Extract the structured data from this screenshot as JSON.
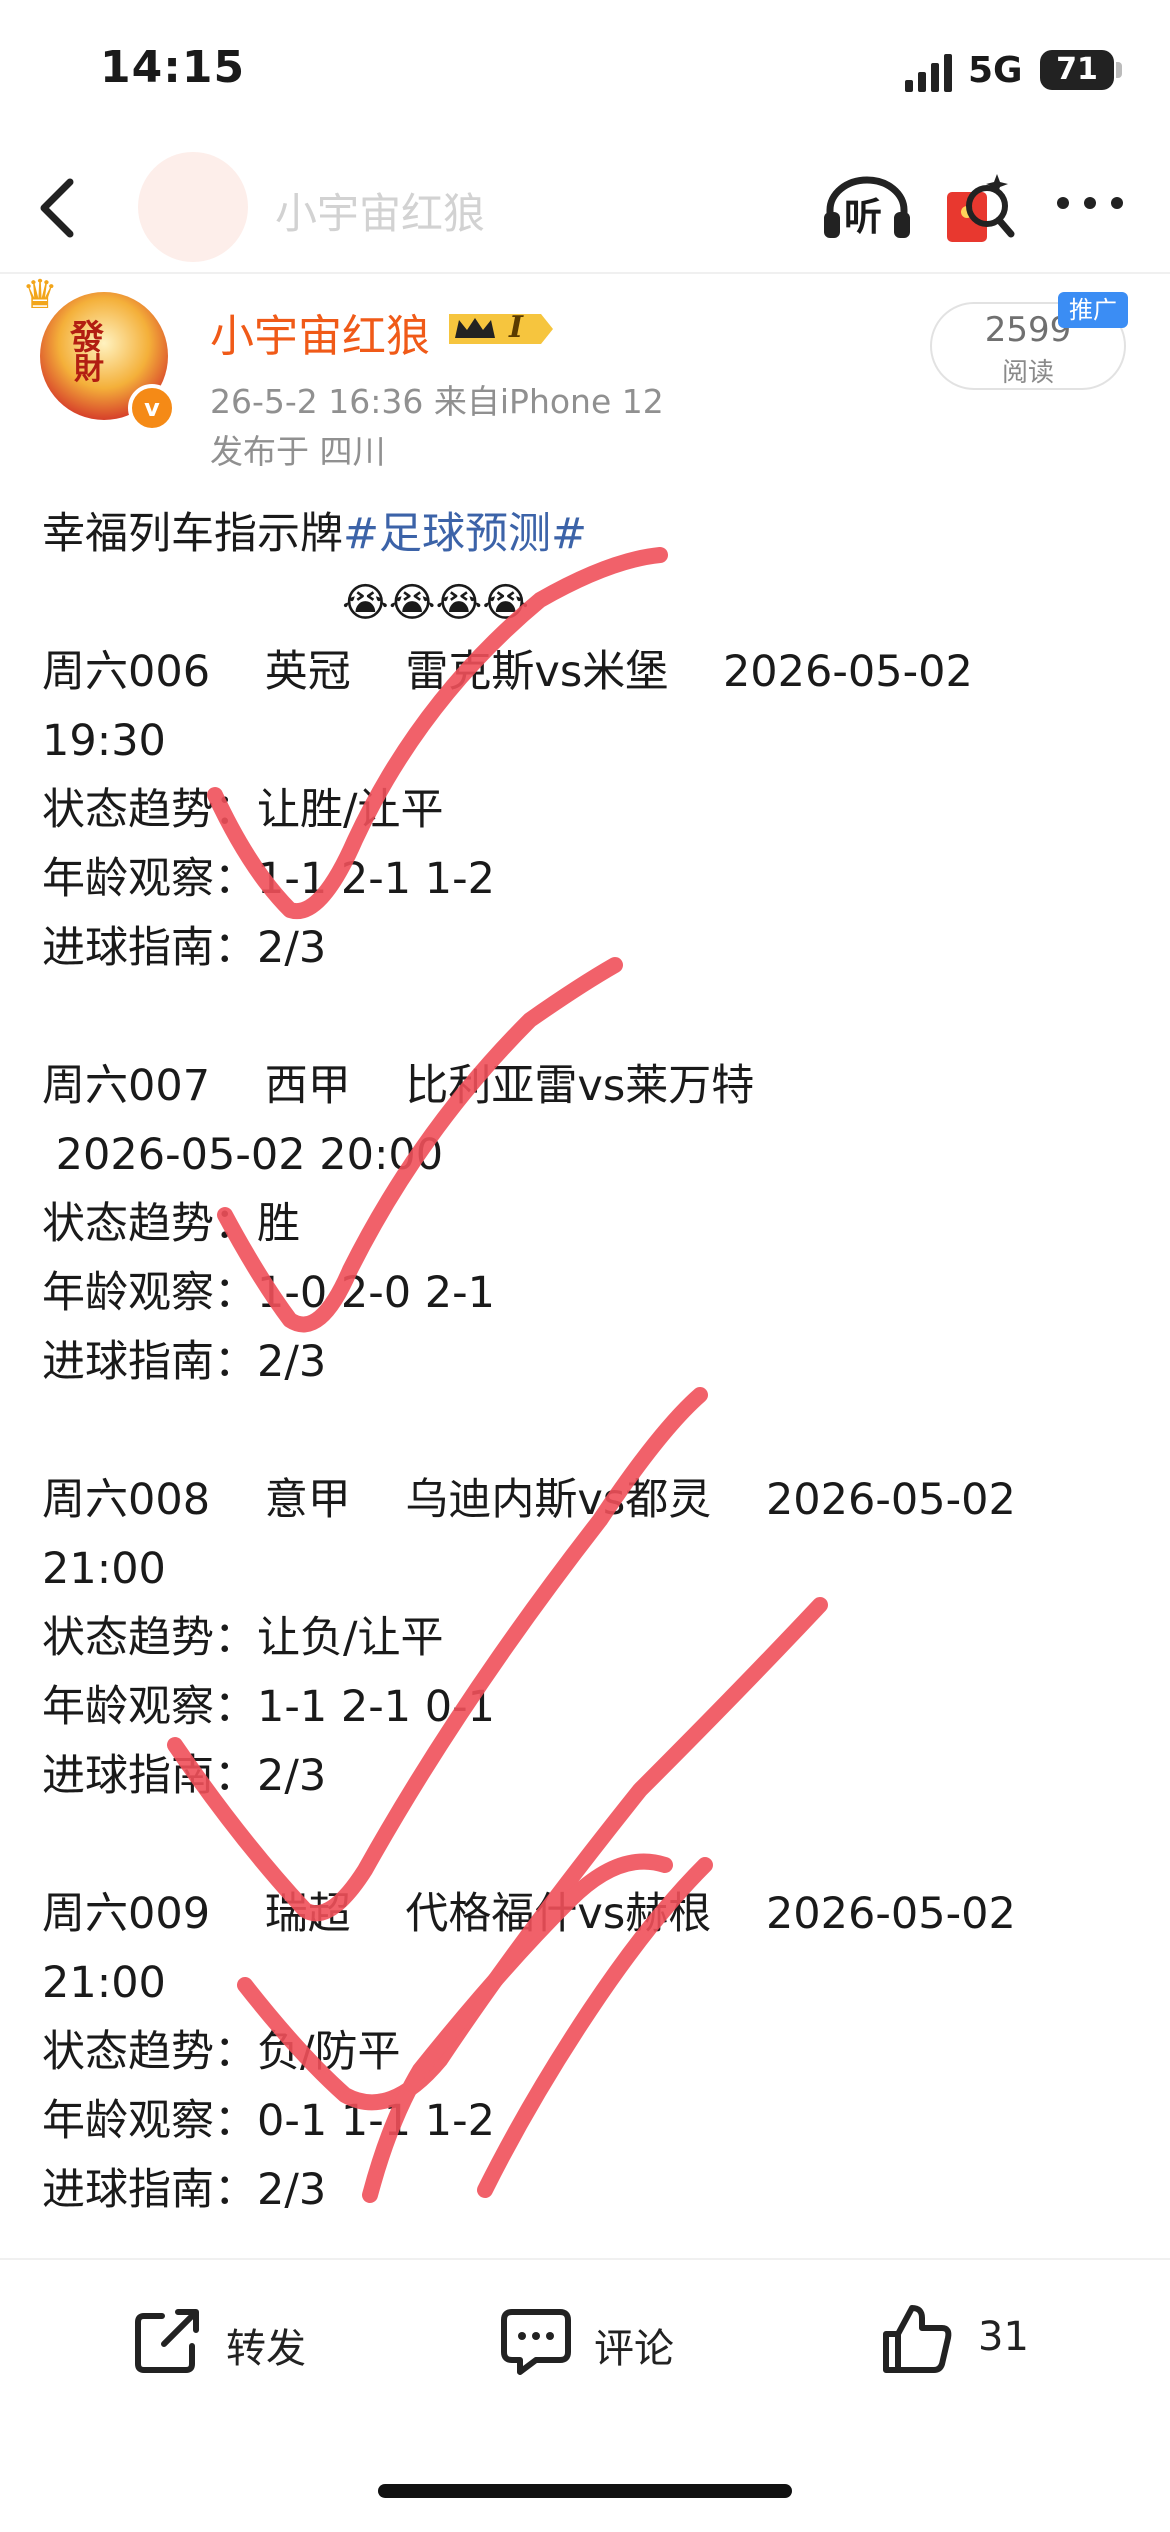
{
  "status_bar": {
    "time": "14:15",
    "network": "5G",
    "battery": "71"
  },
  "nav": {
    "title": "小宇宙红狼",
    "listen_label": "听"
  },
  "author": {
    "name": "小宇宙红狼",
    "avatar_text_1": "發",
    "avatar_text_2": "財",
    "vip_level": "I",
    "meta": "26-5-2 16:36  来自iPhone 12",
    "location": "发布于 四川",
    "verified_badge": "v"
  },
  "reads": {
    "count": "2599",
    "label": "阅读",
    "promo_label": "推广"
  },
  "post": {
    "title_prefix": "幸福列车指示牌",
    "hashtag": "#足球预测#",
    "emojis": "😭😭😭😭",
    "matches": [
      {
        "line1": "周六006    英冠    雷克斯vs米堡    2026-05-02",
        "line2": "19:30",
        "line3": "状态趋势：让胜/让平",
        "line4": "年龄观察：1-1 2-1 1-2",
        "line5": "进球指南：2/3"
      },
      {
        "line1": "周六007    西甲    比利亚雷vs莱万特",
        "line2": " 2026-05-02 20:00",
        "line3": "状态趋势：胜",
        "line4": "年龄观察：1-0 2-0 2-1",
        "line5": "进球指南：2/3"
      },
      {
        "line1": "周六008    意甲    乌迪内斯vs都灵    2026-05-02",
        "line2": "21:00",
        "line3": "状态趋势：让负/让平",
        "line4": "年龄观察：1-1 2-1 0-1",
        "line5": "进球指南：2/3"
      },
      {
        "line1": "周六009    瑞超    代格福什vs赫根    2026-05-02",
        "line2": "21:00",
        "line3": "状态趋势：负/防平",
        "line4": "年龄观察：0-1 1-1 1-2",
        "line5": "进球指南：2/3"
      }
    ]
  },
  "actions": {
    "repost": "转发",
    "comment": "评论",
    "like_count": "31"
  },
  "colors": {
    "accent_orange": "#f05a18",
    "hashtag_blue": "#3c63a8",
    "checkmark_red": "#f0505a",
    "promo_blue": "#3b8df4"
  },
  "icons": [
    "back-icon",
    "headphones-icon",
    "red-packet-icon",
    "more-icon",
    "crown-icon",
    "repost-icon",
    "comment-icon",
    "like-icon"
  ]
}
